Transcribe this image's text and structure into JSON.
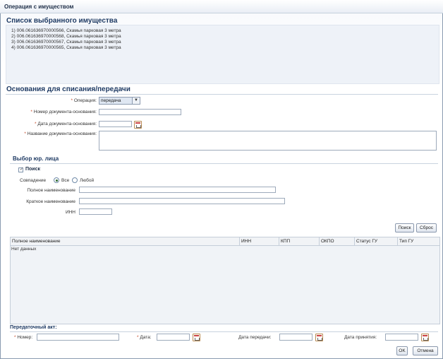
{
  "window": {
    "title": "Операция с имуществом"
  },
  "selected": {
    "heading": "Список выбранного имущества",
    "items": [
      "1) 006.061636970000566, Скамья парковая 3 метра",
      "2) 006.061636970000568, Скамья парковая 3 метра",
      "3) 006.061636970000567, Скамья парковая 3 метра",
      "4) 006.061636970000565, Скамья парковая 3 метра"
    ]
  },
  "basis": {
    "heading": "Основания для списания/передачи",
    "req_mark": "*",
    "operation_label": "Операция:",
    "operation_value": "передача",
    "doc_number_label": "Номер документа-основания:",
    "doc_date_label": "Дата документа-основания:",
    "doc_name_label": "Название документа-основания:"
  },
  "legal": {
    "heading": "Выбор юр. лица",
    "search_toggle": "Поиск",
    "match_label": "Совпадение",
    "match_all": "Все",
    "match_any": "Любой",
    "full_name_label": "Полное наименование",
    "short_name_label": "Краткое наименование",
    "inn_label": "ИНН",
    "search_button": "Поиск",
    "reset_button": "Сброс"
  },
  "grid": {
    "columns": [
      "Полное наименование",
      "ИНН",
      "КПП",
      "ОКПО",
      "Статус ГУ",
      "Тип ГУ"
    ],
    "empty_text": "Нет данных"
  },
  "act": {
    "heading": "Передаточный акт:",
    "number_label": "Номер:",
    "date_label": "Дата:",
    "transfer_date_label": "Дата передачи:",
    "accept_date_label": "Дата принятия:"
  },
  "footer": {
    "ok_label": "OK",
    "cancel_label": "Отмена"
  }
}
